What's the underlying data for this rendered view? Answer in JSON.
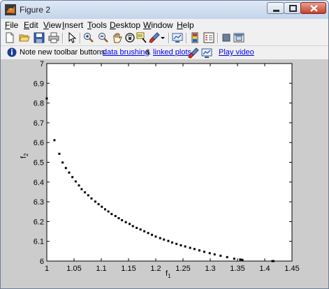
{
  "window": {
    "title": "Figure 2"
  },
  "menu": [
    {
      "label": "File",
      "mnemonic": "F",
      "rest": "ile"
    },
    {
      "label": "Edit",
      "mnemonic": "E",
      "rest": "dit"
    },
    {
      "label": "View",
      "mnemonic": "V",
      "rest": "iew"
    },
    {
      "label": "Insert",
      "mnemonic": "I",
      "rest": "nsert"
    },
    {
      "label": "Tools",
      "mnemonic": "T",
      "rest": "ools"
    },
    {
      "label": "Desktop",
      "mnemonic": "D",
      "rest": "esktop"
    },
    {
      "label": "Window",
      "mnemonic": "W",
      "rest": "indow"
    },
    {
      "label": "Help",
      "mnemonic": "H",
      "rest": "elp"
    }
  ],
  "toolbar": {
    "buttons": [
      "new-figure-icon",
      "open-file-icon",
      "save-icon",
      "print-icon",
      "edit-plot-arrow-icon",
      "zoom-in-icon",
      "zoom-out-icon",
      "pan-hand-icon",
      "rotate-3d-icon",
      "data-cursor-icon",
      "brush-icon",
      "brush-dropdown-icon",
      "link-plot-icon",
      "insert-colorbar-icon",
      "insert-legend-icon",
      "hide-plot-tools-icon",
      "show-plot-tools-icon"
    ]
  },
  "note": {
    "prefix": "Note new toolbar buttons:",
    "link1": "data brushing",
    "amp": "&",
    "link2": "linked plots",
    "video": "Play video"
  },
  "chart_data": {
    "type": "scatter",
    "title": "",
    "xlabel": "f1",
    "ylabel": "f2",
    "xlabel_main": "f",
    "xlabel_sub": "1",
    "ylabel_main": "f",
    "ylabel_sub": "2",
    "xlim": [
      1,
      1.45
    ],
    "ylim": [
      6,
      7
    ],
    "grid": false,
    "xticks": [
      "1",
      "1.05",
      "1.1",
      "1.15",
      "1.2",
      "1.25",
      "1.3",
      "1.35",
      "1.4",
      "1.45"
    ],
    "yticks": [
      "6",
      "6.1",
      "6.2",
      "6.3",
      "6.4",
      "6.5",
      "6.6",
      "6.7",
      "6.8",
      "6.9",
      "7"
    ],
    "marker_color": "#000000",
    "series": [
      {
        "x": [
          1.0,
          1.014,
          1.023,
          1.029,
          1.035,
          1.041,
          1.047,
          1.053,
          1.059,
          1.064,
          1.07,
          1.076,
          1.082,
          1.089,
          1.095,
          1.101,
          1.107,
          1.113,
          1.119,
          1.126,
          1.132,
          1.138,
          1.145,
          1.152,
          1.158,
          1.165,
          1.172,
          1.179,
          1.186,
          1.193,
          1.2,
          1.208,
          1.215,
          1.223,
          1.23,
          1.238,
          1.246,
          1.254,
          1.263,
          1.271,
          1.28,
          1.289,
          1.299,
          1.308,
          1.319,
          1.331,
          1.344,
          1.355,
          1.359,
          1.414,
          1.416
        ],
        "y": [
          6.823,
          6.612,
          6.543,
          6.499,
          6.471,
          6.448,
          6.425,
          6.403,
          6.383,
          6.364,
          6.348,
          6.333,
          6.317,
          6.301,
          6.288,
          6.275,
          6.262,
          6.251,
          6.238,
          6.228,
          6.217,
          6.207,
          6.197,
          6.188,
          6.177,
          6.168,
          6.16,
          6.151,
          6.142,
          6.133,
          6.124,
          6.116,
          6.109,
          6.102,
          6.094,
          6.087,
          6.08,
          6.074,
          6.067,
          6.061,
          6.054,
          6.047,
          6.04,
          6.034,
          6.027,
          6.02,
          6.012,
          6.008,
          6.006,
          6.0,
          6.0
        ]
      }
    ]
  }
}
